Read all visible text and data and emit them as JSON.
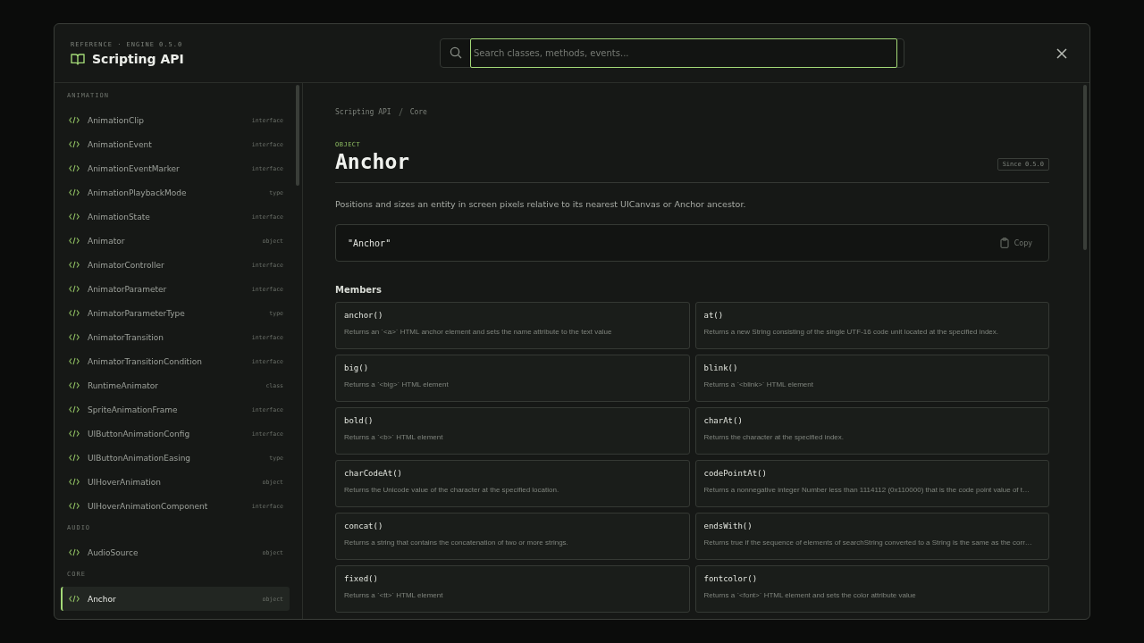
{
  "header": {
    "eyebrow": "REFERENCE · ENGINE 0.5.0",
    "title": "Scripting API"
  },
  "search": {
    "placeholder": "Search classes, methods, events..."
  },
  "sidebar": {
    "groups": [
      {
        "label": "ANIMATION",
        "items": [
          {
            "name": "AnimationClip",
            "type": "interface",
            "selected": false
          },
          {
            "name": "AnimationEvent",
            "type": "interface",
            "selected": false
          },
          {
            "name": "AnimationEventMarker",
            "type": "interface",
            "selected": false
          },
          {
            "name": "AnimationPlaybackMode",
            "type": "type",
            "selected": false
          },
          {
            "name": "AnimationState",
            "type": "interface",
            "selected": false
          },
          {
            "name": "Animator",
            "type": "object",
            "selected": false
          },
          {
            "name": "AnimatorController",
            "type": "interface",
            "selected": false
          },
          {
            "name": "AnimatorParameter",
            "type": "interface",
            "selected": false
          },
          {
            "name": "AnimatorParameterType",
            "type": "type",
            "selected": false
          },
          {
            "name": "AnimatorTransition",
            "type": "interface",
            "selected": false
          },
          {
            "name": "AnimatorTransitionCondition",
            "type": "interface",
            "selected": false
          },
          {
            "name": "RuntimeAnimator",
            "type": "class",
            "selected": false
          },
          {
            "name": "SpriteAnimationFrame",
            "type": "interface",
            "selected": false
          },
          {
            "name": "UIButtonAnimationConfig",
            "type": "interface",
            "selected": false
          },
          {
            "name": "UIButtonAnimationEasing",
            "type": "type",
            "selected": false
          },
          {
            "name": "UIHoverAnimation",
            "type": "object",
            "selected": false
          },
          {
            "name": "UIHoverAnimationComponent",
            "type": "interface",
            "selected": false
          }
        ]
      },
      {
        "label": "AUDIO",
        "items": [
          {
            "name": "AudioSource",
            "type": "object",
            "selected": false
          }
        ]
      },
      {
        "label": "CORE",
        "items": [
          {
            "name": "Anchor",
            "type": "object",
            "selected": true
          }
        ]
      }
    ]
  },
  "breadcrumb": [
    "Scripting API",
    "Core"
  ],
  "doc": {
    "kind": "OBJECT",
    "title": "Anchor",
    "since": "Since 0.5.0",
    "description": "Positions and sizes an entity in screen pixels relative to its nearest UICanvas or Anchor ancestor.",
    "code": "\"Anchor\"",
    "copy": "Copy",
    "members_title": "Members"
  },
  "members": [
    {
      "name": "anchor()",
      "desc": "Returns an `<a>` HTML anchor element and sets the name attribute to the text value"
    },
    {
      "name": "at()",
      "desc": "Returns a new String consisting of the single UTF-16 code unit located at the specified index."
    },
    {
      "name": "big()",
      "desc": "Returns a `<big>` HTML element"
    },
    {
      "name": "blink()",
      "desc": "Returns a `<blink>` HTML element"
    },
    {
      "name": "bold()",
      "desc": "Returns a `<b>` HTML element"
    },
    {
      "name": "charAt()",
      "desc": "Returns the character at the specified index."
    },
    {
      "name": "charCodeAt()",
      "desc": "Returns the Unicode value of the character at the specified location."
    },
    {
      "name": "codePointAt()",
      "desc": "Returns a nonnegative integer Number less than 1114112 (0x110000) that is the code point value of t…"
    },
    {
      "name": "concat()",
      "desc": "Returns a string that contains the concatenation of two or more strings."
    },
    {
      "name": "endsWith()",
      "desc": "Returns true if the sequence of elements of searchString converted to a String is the same as the corr…"
    },
    {
      "name": "fixed()",
      "desc": "Returns a `<tt>` HTML element"
    },
    {
      "name": "fontcolor()",
      "desc": "Returns a `<font>` HTML element and sets the color attribute value"
    }
  ]
}
